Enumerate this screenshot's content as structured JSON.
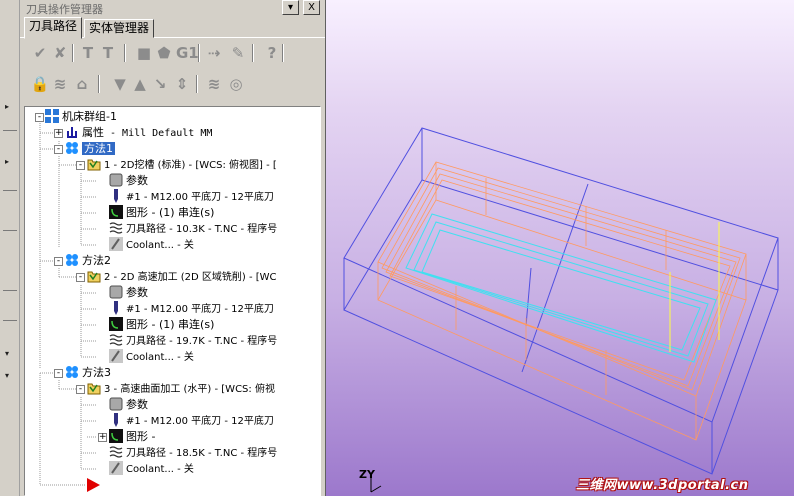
{
  "panel": {
    "title": "刀具操作管理器",
    "pin_glyph": "▾",
    "close_glyph": "X",
    "tabs": [
      {
        "label": "刀具路径",
        "active": true
      },
      {
        "label": "实体管理器",
        "active": false
      }
    ]
  },
  "toolbar1": [
    {
      "name": "select-all-icon",
      "glyph": "✔"
    },
    {
      "name": "select-dirty-icon",
      "glyph": "✘"
    },
    {
      "name": "regen-all-icon",
      "glyph": "T"
    },
    {
      "name": "regen-dirty-icon",
      "glyph": "T"
    },
    {
      "name": "backplot-icon",
      "glyph": "■"
    },
    {
      "name": "verify-icon",
      "glyph": "⬟"
    },
    {
      "name": "post-icon",
      "glyph": "G1"
    },
    {
      "name": "highfeed-icon",
      "glyph": "⇢"
    },
    {
      "name": "delete-ops-icon",
      "glyph": "✎"
    },
    {
      "name": "help-icon",
      "glyph": "?"
    }
  ],
  "toolbar2": [
    {
      "name": "lock-icon",
      "glyph": "🔒"
    },
    {
      "name": "toggle-display-icon",
      "glyph": "≋"
    },
    {
      "name": "toggle-post-icon",
      "glyph": "⌂"
    },
    {
      "name": "move-down-icon",
      "glyph": "▼"
    },
    {
      "name": "move-up-icon",
      "glyph": "▲"
    },
    {
      "name": "insert-arrow-icon",
      "glyph": "↘"
    },
    {
      "name": "scroll-icon",
      "glyph": "⇕"
    },
    {
      "name": "single-op-icon",
      "glyph": "≋"
    },
    {
      "name": "collapse-icon",
      "glyph": "◎"
    }
  ],
  "tree": {
    "machine_group": "机床群组-1",
    "properties_label": "属性",
    "properties_value": " - Mill Default MM",
    "ops": [
      {
        "group": "方法1",
        "op": "1 - 2D挖槽 (标准) - [WCS: 俯视图] - [",
        "params": "参数",
        "tool": "#1 - M12.00 平底刀 - 12平底刀",
        "geometry": "图形 - (1) 串连(s)",
        "path": "刀具路径 - 10.3K - T.NC - 程序号",
        "coolant": "Coolant... - 关"
      },
      {
        "group": "方法2",
        "op": "2 - 2D 高速加工 (2D 区域铣削) - [WC",
        "params": "参数",
        "tool": "#1 - M12.00 平底刀 - 12平底刀",
        "geometry": "图形 - (1) 串连(s)",
        "path": "刀具路径 - 19.7K - T.NC - 程序号",
        "coolant": "Coolant... - 关"
      },
      {
        "group": "方法3",
        "op": "3 - 高速曲面加工 (水平) - [WCS: 俯视",
        "params": "参数",
        "tool": "#1 - M12.00 平底刀 - 12平底刀",
        "geometry": "图形 -",
        "path": "刀具路径 - 18.5K - T.NC - 程序号",
        "coolant": "Coolant... - 关"
      }
    ]
  },
  "viewport": {
    "axis_label": "ZY",
    "watermark": "三维网www.3dportal.cn",
    "colors": {
      "box": "#5050e0",
      "toolpath": "#ff9a60",
      "finish": "#40e0f0",
      "accent": "#ffff40",
      "gradient_top": "#f8f0ff",
      "gradient_bottom": "#9c78cc"
    }
  }
}
